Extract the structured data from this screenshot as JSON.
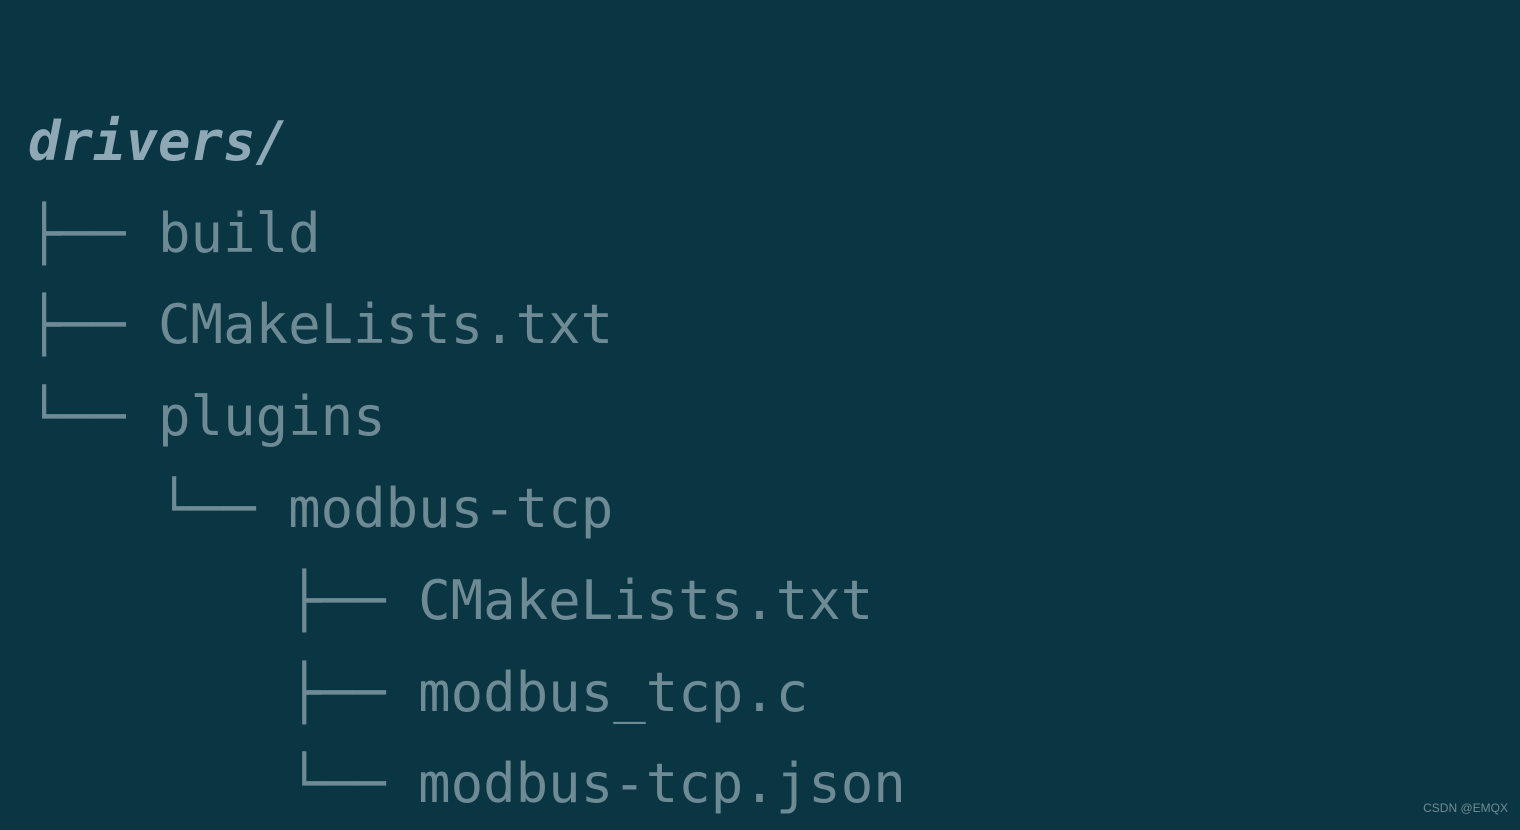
{
  "tree": {
    "root": "drivers/",
    "items": [
      {
        "prefix": "├── ",
        "name": "build"
      },
      {
        "prefix": "├── ",
        "name": "CMakeLists.txt"
      },
      {
        "prefix": "└── ",
        "name": "plugins"
      },
      {
        "prefix": "    └── ",
        "name": "modbus-tcp"
      },
      {
        "prefix": "        ├── ",
        "name": "CMakeLists.txt"
      },
      {
        "prefix": "        ├── ",
        "name": "modbus_tcp.c"
      },
      {
        "prefix": "        └── ",
        "name": "modbus-tcp.json"
      }
    ]
  },
  "watermark": "CSDN @EMQX"
}
